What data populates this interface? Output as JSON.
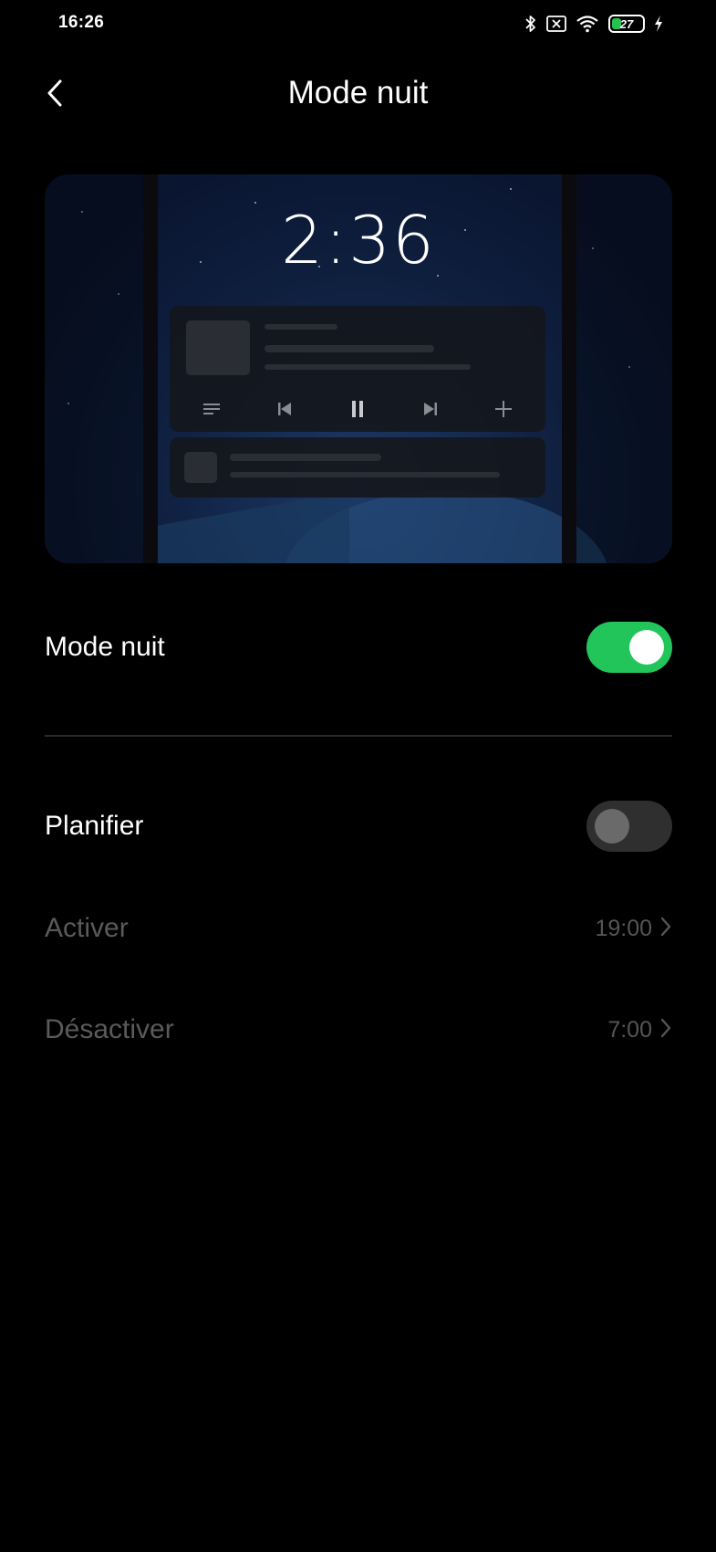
{
  "status_bar": {
    "time": "16:26",
    "battery": "27",
    "icons": [
      "bluetooth-icon",
      "no-sim-icon",
      "wifi-icon",
      "battery-icon",
      "charging-icon"
    ]
  },
  "header": {
    "title": "Mode nuit",
    "back_icon": "chevron-left-icon"
  },
  "preview": {
    "clock": "2:36",
    "music_controls": [
      "playlist-icon",
      "previous-icon",
      "pause-icon",
      "next-icon",
      "add-icon"
    ]
  },
  "settings": {
    "night_mode": {
      "label": "Mode nuit",
      "enabled": true
    },
    "schedule": {
      "label": "Planifier",
      "enabled": false
    },
    "activate": {
      "label": "Activer",
      "value": "19:00"
    },
    "deactivate": {
      "label": "Désactiver",
      "value": "7:00"
    }
  },
  "colors": {
    "background": "#000000",
    "toggle_on": "#22c55a",
    "toggle_off": "#2f2f2f",
    "disabled_text": "#5a5a5a"
  }
}
